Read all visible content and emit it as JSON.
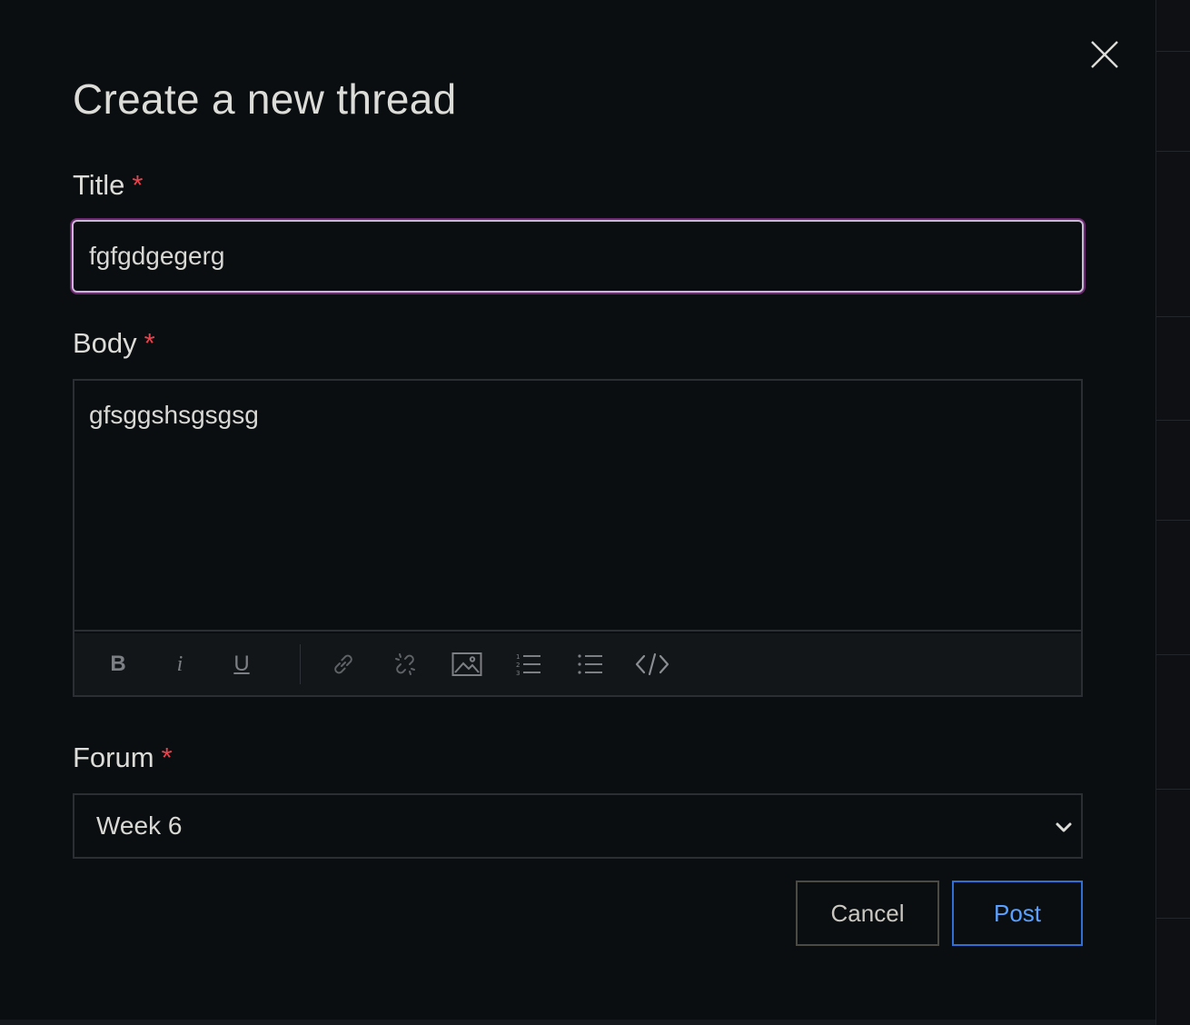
{
  "modal": {
    "title": "Create a new thread",
    "close_icon": "close-icon"
  },
  "form": {
    "title_field": {
      "label": "Title",
      "required_mark": "*",
      "value": "fgfgdgegerg"
    },
    "body_field": {
      "label": "Body",
      "required_mark": "*",
      "value": "gfsggshsgsgsg",
      "toolbar": [
        {
          "name": "bold-icon",
          "glyph": "B"
        },
        {
          "name": "italic-icon",
          "glyph": "i"
        },
        {
          "name": "underline-icon",
          "glyph": "U"
        },
        {
          "name": "link-icon"
        },
        {
          "name": "unlink-icon"
        },
        {
          "name": "image-icon"
        },
        {
          "name": "ordered-list-icon"
        },
        {
          "name": "unordered-list-icon"
        },
        {
          "name": "code-icon"
        }
      ]
    },
    "forum_field": {
      "label": "Forum",
      "required_mark": "*",
      "selected": "Week 6"
    }
  },
  "actions": {
    "cancel_label": "Cancel",
    "post_label": "Post"
  },
  "colors": {
    "background": "#0b0e11",
    "text": "#dcdcd8",
    "required": "#e8424c",
    "focus_ring": "#6b2a6f",
    "post_accent": "#2f6fd6"
  }
}
